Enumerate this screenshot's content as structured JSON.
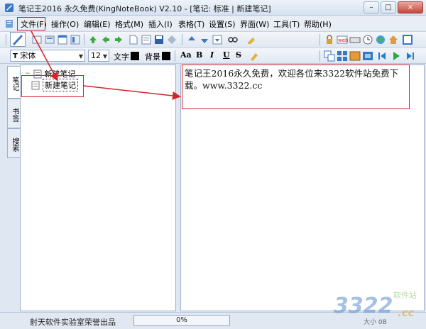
{
  "window": {
    "title": "笔记王2016 永久免费(KingNoteBook) V2.10 - [笔记: 标准 | 新建笔记]",
    "buttons": {
      "minimize": "–",
      "maximize": "□",
      "close": "×"
    }
  },
  "menu": {
    "items": [
      "文件(F)",
      "操作(O)",
      "编辑(E)",
      "格式(M)",
      "插入(I)",
      "表格(T)",
      "设置(S)",
      "界面(W)",
      "工具(T)",
      "帮助(H)"
    ]
  },
  "format_bar": {
    "font_name": "宋体",
    "font_size": "12",
    "text_color_label": "文字",
    "bg_color_label": "背景",
    "text_color": "#000000",
    "bg_color": "#000000",
    "font_btn": "Aa",
    "bold": "B",
    "italic": "I",
    "underline": "U",
    "strike": "S"
  },
  "side_tabs": [
    "笔记",
    "书签",
    "搜索"
  ],
  "tree": {
    "root_label": "新建笔记",
    "child_label": "新建笔记"
  },
  "editor": {
    "content": "笔记王2016永久免费，欢迎各位来3322软件站免费下载。www.3322.cc"
  },
  "status": {
    "text": "射天软件实验室荣誉出品",
    "progress_percent": 0,
    "progress_label": "0%",
    "size_label": "大小 0B"
  },
  "watermark": {
    "number": "3322",
    "site": "软件站",
    "domain": ".cc"
  },
  "colors": {
    "annotation_red": "#d2242a",
    "panel_border": "#9fb2cc"
  }
}
